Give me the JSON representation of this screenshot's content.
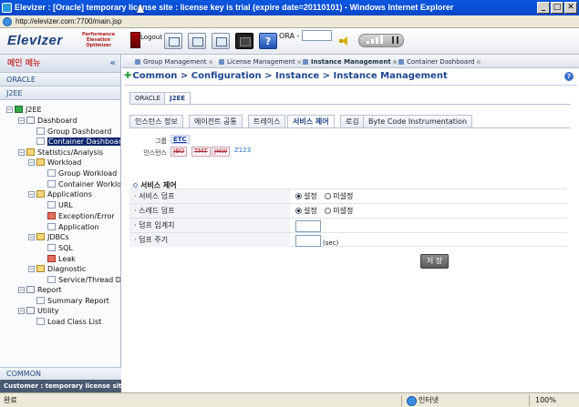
{
  "window": {
    "title": "Elevizer : [Oracle] temporary license site : license key is trial (expire date=20110101) - Windows Internet Explorer",
    "controls": [
      "_",
      "□",
      "✕"
    ]
  },
  "address": {
    "url": "http://elevizer.com:7700/main.jsp"
  },
  "toolbar": {
    "logo": "ElevIzer",
    "tagline": [
      "Performance",
      "Elevation",
      "Optimizer"
    ],
    "logout_label": "Logout",
    "ora_label": "ORA -"
  },
  "sidebar": {
    "menu_title": "메인 메뉴",
    "collapse": "«",
    "sections": [
      "ORACLE",
      "J2EE"
    ],
    "tree": [
      {
        "label": "J2EE",
        "icon": "j2ee-icon"
      },
      {
        "label": "Dashboard",
        "icon": "dashboard-icon"
      },
      {
        "label": "Group Dashboard",
        "icon": "page-icon"
      },
      {
        "label": "Container Dashboard",
        "icon": "page-icon"
      },
      {
        "label": "Statistics/Analysis",
        "icon": "folder-icon"
      },
      {
        "label": "Workload",
        "icon": "folder-icon"
      },
      {
        "label": "Group Workload",
        "icon": "page-icon"
      },
      {
        "label": "Container Workload",
        "icon": "page-icon"
      },
      {
        "label": "Applications",
        "icon": "folder-icon"
      },
      {
        "label": "URL",
        "icon": "page-icon"
      },
      {
        "label": "Exception/Error",
        "icon": "page-icon"
      },
      {
        "label": "Application",
        "icon": "page-icon"
      },
      {
        "label": "JDBCs",
        "icon": "folder-icon"
      },
      {
        "label": "SQL",
        "icon": "page-icon"
      },
      {
        "label": "Leak",
        "icon": "page-icon"
      },
      {
        "label": "Diagnostic",
        "icon": "folder-icon"
      },
      {
        "label": "Service/Thread Dump",
        "icon": "page-icon"
      },
      {
        "label": "Report",
        "icon": "report-icon"
      },
      {
        "label": "Summary Report",
        "icon": "page-icon"
      },
      {
        "label": "Utility",
        "icon": "utility-icon"
      },
      {
        "label": "Load Class List",
        "icon": "page-icon"
      }
    ],
    "bottom_section": "COMMON",
    "customer": "Customer : temporary license site"
  },
  "content": {
    "tabs": [
      {
        "label": "Group Management"
      },
      {
        "label": "License Management"
      },
      {
        "label": "Instance Management"
      },
      {
        "label": "Container Dashboard"
      }
    ],
    "breadcrumb": "Common > Configuration > Instance > Instance Management",
    "help": "?",
    "instance_tabs": [
      "ORACLE",
      "J2EE"
    ],
    "sub_tabs": [
      "인스턴스 정보",
      "에이전트 공통",
      "트레이스",
      "서비스 제어",
      "로깅",
      "Byte Code Instrumentation"
    ],
    "group_label": "그룹",
    "group_value": "ETC",
    "instance_label": "인스턴스",
    "instances": [
      "JBO",
      "TMT",
      "JHW",
      "Z123"
    ],
    "section_title": "서비스 제어",
    "rows": [
      {
        "label": "· 서비스 덤프",
        "opt_on": "설정",
        "opt_off": "미설정"
      },
      {
        "label": "· 스레드 덤프",
        "opt_on": "설정",
        "opt_off": "미설정"
      },
      {
        "label": "· 덤프 임계치"
      },
      {
        "label": "· 덤프 주기",
        "unit": "(sec)"
      }
    ],
    "save_label": "저 장"
  },
  "status": {
    "left": "완료",
    "zone": "인터넷",
    "zoom": "100%"
  }
}
